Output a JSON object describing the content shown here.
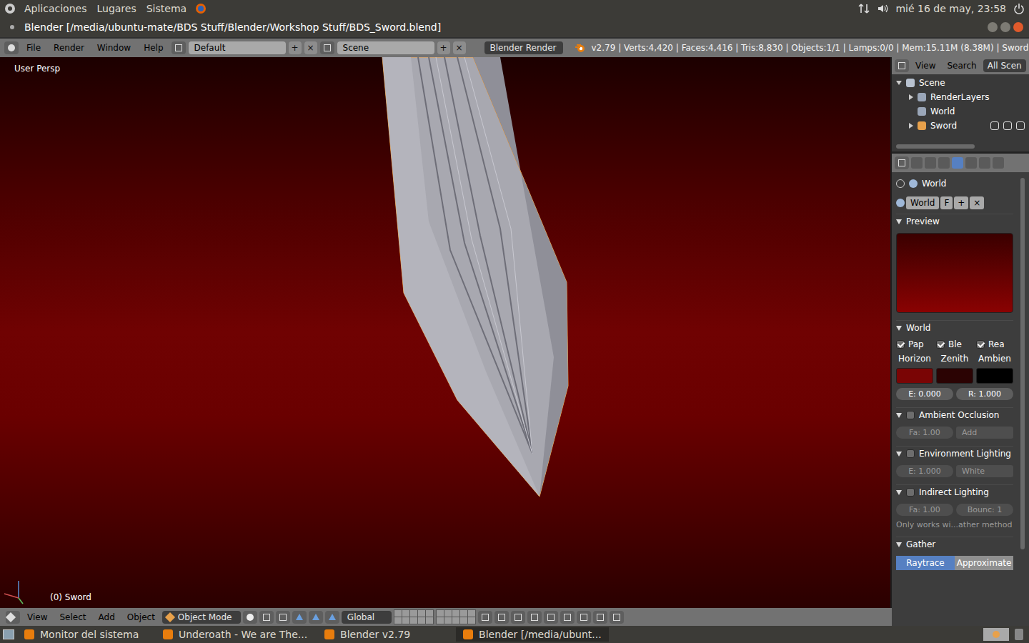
{
  "top_panel": {
    "menus": [
      "Aplicaciones",
      "Lugares",
      "Sistema"
    ],
    "clock": "mié 16 de may, 23:58"
  },
  "window": {
    "title": "Blender [/media/ubuntu-mate/BDS Stuff/Blender/Workshop Stuff/BDS_Sword.blend]"
  },
  "info_header": {
    "menus": [
      "File",
      "Render",
      "Window",
      "Help"
    ],
    "layout": "Default",
    "scene": "Scene",
    "engine": "Blender Render",
    "stats": "v2.79 | Verts:4,420 | Faces:4,416 | Tris:8,830 | Objects:1/1 | Lamps:0/0 | Mem:15.11M (8.38M) | Sword"
  },
  "viewport": {
    "view_label": "User Persp",
    "object_label": "(0) Sword"
  },
  "viewport_header": {
    "menus": [
      "View",
      "Select",
      "Add",
      "Object"
    ],
    "mode": "Object Mode",
    "orientation": "Global"
  },
  "outliner": {
    "menus": [
      "View",
      "Search"
    ],
    "filter": "All Scen",
    "tree": [
      {
        "label": "Scene",
        "expanded": true,
        "children": [
          {
            "label": "RenderLayers",
            "expanded": false,
            "selected": false
          },
          {
            "label": "World",
            "expanded": false,
            "selected": false
          },
          {
            "label": "Sword",
            "expanded": false,
            "selected": true
          }
        ]
      }
    ]
  },
  "properties": {
    "context": "World",
    "datablock": "World",
    "fake_user": "F",
    "tabs": [
      {
        "selected": false
      },
      {
        "selected": false
      },
      {
        "selected": false
      },
      {
        "selected": true
      },
      {
        "selected": false
      },
      {
        "selected": false
      },
      {
        "selected": false
      }
    ],
    "preview": {
      "title": "Preview",
      "expanded": true
    },
    "world": {
      "title": "World",
      "expanded": true,
      "options": [
        {
          "label": "Pap",
          "checked": true
        },
        {
          "label": "Ble",
          "checked": true
        },
        {
          "label": "Rea",
          "checked": true
        }
      ],
      "colors": [
        {
          "label": "Horizon",
          "color": "#7a0505"
        },
        {
          "label": "Zenith",
          "color": "#2b0303"
        },
        {
          "label": "Ambien",
          "color": "#000000"
        }
      ],
      "fields": [
        "E: 0.000",
        "R: 1.000"
      ]
    },
    "sections": [
      {
        "title": "Ambient Occlusion",
        "expanded": true,
        "checked": false,
        "fields": [
          {
            "label": "Fa: 1.00",
            "kind": "number"
          },
          {
            "label": "Add",
            "kind": "menu"
          }
        ],
        "note": ""
      },
      {
        "title": "Environment Lighting",
        "expanded": true,
        "checked": false,
        "fields": [
          {
            "label": "E: 1.000",
            "kind": "number"
          },
          {
            "label": "White",
            "kind": "menu"
          }
        ],
        "note": ""
      },
      {
        "title": "Indirect Lighting",
        "expanded": true,
        "checked": false,
        "fields": [
          {
            "label": "Fa: 1.00",
            "kind": "number"
          },
          {
            "label": "Bounc: 1",
            "kind": "number"
          }
        ],
        "note": "Only works wi...ather method"
      }
    ],
    "gather": {
      "title": "Gather",
      "expanded": true,
      "options": [
        {
          "label": "Raytrace",
          "selected": true
        },
        {
          "label": "Approximate",
          "selected": false
        }
      ]
    }
  },
  "taskbar": [
    {
      "label": "Monitor del sistema",
      "selected": false
    },
    {
      "label": "Underoath - We are The...",
      "selected": false
    },
    {
      "label": "Blender v2.79",
      "selected": false
    },
    {
      "label": "Blender [/media/ubunt...",
      "selected": true
    }
  ]
}
